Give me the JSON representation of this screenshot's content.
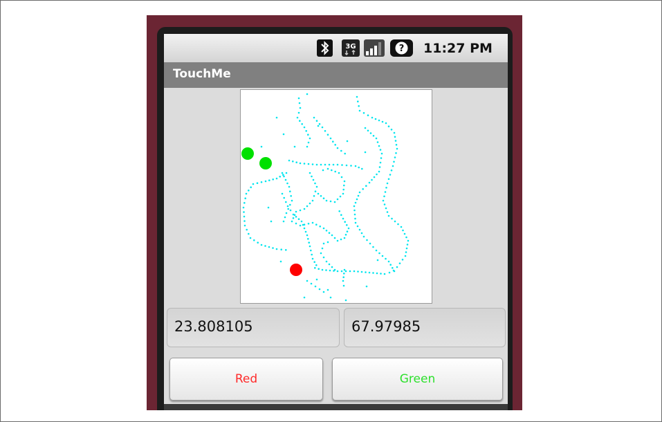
{
  "status_bar": {
    "time": "11:27 PM",
    "icons": [
      "bluetooth-icon",
      "signal-3g-icon",
      "signal-bars-icon",
      "battery-icon"
    ],
    "network_label": "3G"
  },
  "app": {
    "title": "TouchMe"
  },
  "canvas": {
    "background": "#ffffff",
    "trail_color": "#00e5ee",
    "dots": [
      {
        "color": "#00e000"
      },
      {
        "color": "#00e000"
      },
      {
        "color": "#ff0000"
      }
    ]
  },
  "coordinates": {
    "x_value": "23.808105",
    "y_value": "67.97985"
  },
  "buttons": {
    "red_label": "Red",
    "red_color": "#ff2a2a",
    "green_label": "Green",
    "green_color": "#2ee02e"
  }
}
